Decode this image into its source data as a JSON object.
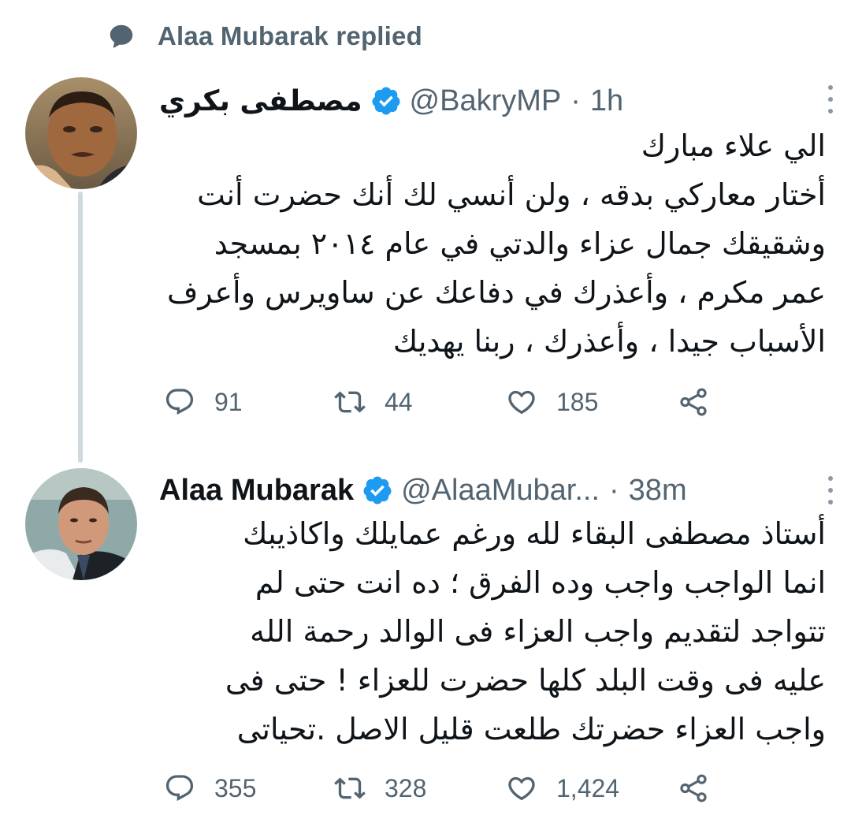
{
  "social_context": {
    "icon": "speech-bubble-icon",
    "text": "Alaa Mubarak replied"
  },
  "colors": {
    "primary_text": "#0f1419",
    "secondary_text": "#536471",
    "verified_blue": "#1d9bf0",
    "thread_line": "#cfd9de"
  },
  "tweets": [
    {
      "author": {
        "display_name": "مصطفى بكري",
        "handle": "@BakryMP",
        "verified": true
      },
      "separator": "·",
      "time": "1h",
      "lines": [
        "الي علاء مبارك",
        "أختار معاركي بدقه ، ولن أنسي لك أنك حضرت أنت",
        "وشقيقك جمال عزاء والدتي في عام ٢٠١٤ بمسجد",
        "عمر مكرم  ، وأعذرك في دفاعك عن ساويرس وأعرف",
        "الأسباب جيدا ، وأعذرك ، ربنا يهديك"
      ],
      "stats": {
        "replies": "91",
        "retweets": "44",
        "likes": "185"
      }
    },
    {
      "author": {
        "display_name": "Alaa Mubarak",
        "handle": "@AlaaMubar...",
        "verified": true
      },
      "separator": "·",
      "time": "38m",
      "lines": [
        "أستاذ مصطفى  البقاء لله ورغم عمايلك واكاذيبك",
        "انما الواجب واجب وده الفرق ؛ ده انت حتى لم",
        "تتواجد لتقديم واجب العزاء فى الوالد رحمة الله",
        "عليه فى وقت البلد كلها حضرت للعزاء !  حتى فى",
        "واجب العزاء حضرتك طلعت قليل الاصل .تحياتى"
      ],
      "stats": {
        "replies": "355",
        "retweets": "328",
        "likes": "1,424"
      }
    }
  ]
}
